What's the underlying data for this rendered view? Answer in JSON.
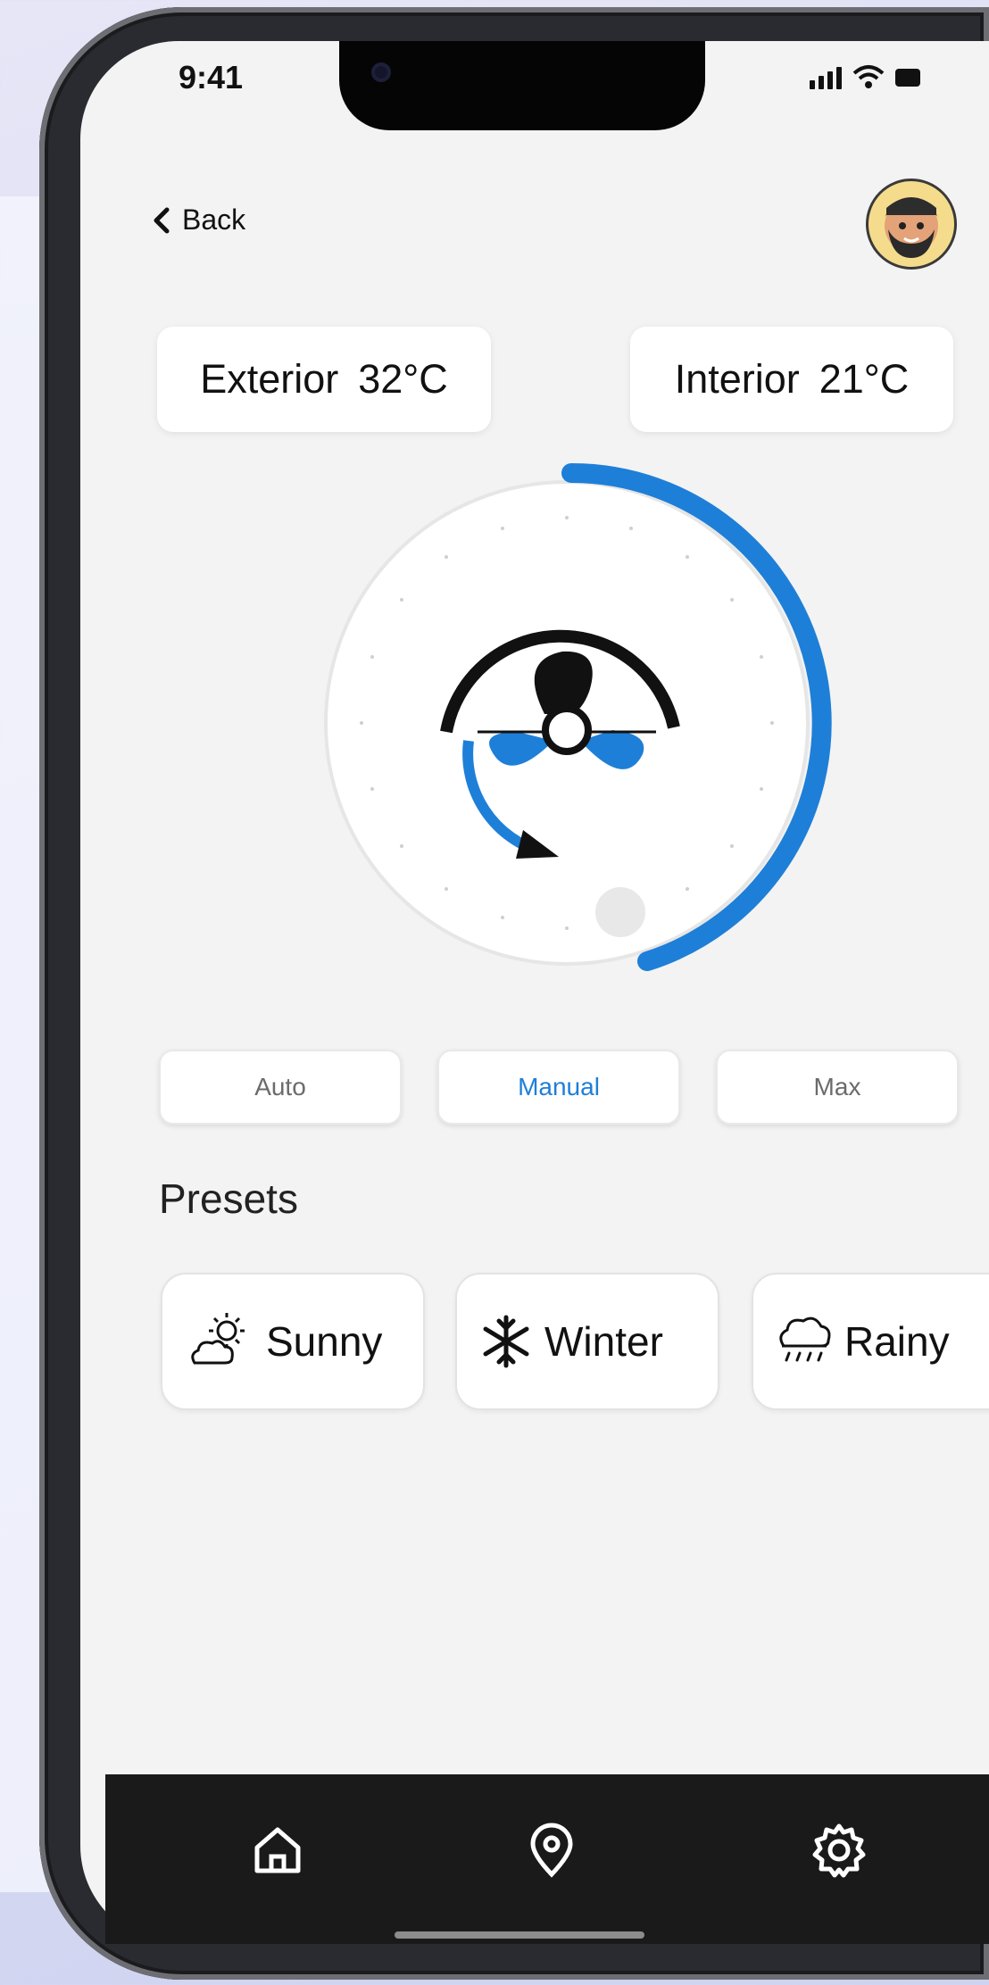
{
  "status_bar": {
    "time": "9:41"
  },
  "header": {
    "back_label": "Back"
  },
  "temperatures": {
    "exterior_label": "Exterior",
    "exterior_value": "32°C",
    "interior_label": "Interior",
    "interior_value": "21°C"
  },
  "fan": {
    "level_fraction": 0.45
  },
  "modes": [
    {
      "label": "Auto",
      "active": false
    },
    {
      "label": "Manual",
      "active": true
    },
    {
      "label": "Max",
      "active": false
    }
  ],
  "presets": {
    "title": "Presets",
    "items": [
      {
        "label": "Sunny",
        "icon": "sun-cloud-icon"
      },
      {
        "label": "Winter",
        "icon": "snowflake-icon"
      },
      {
        "label": "Rainy",
        "icon": "rain-cloud-icon"
      }
    ]
  },
  "nav": {
    "items": [
      "home-icon",
      "location-icon",
      "settings-icon"
    ]
  },
  "colors": {
    "accent": "#1e7fd8",
    "navbar": "#1a1a1a",
    "screen_bg": "#f3f3f3"
  }
}
